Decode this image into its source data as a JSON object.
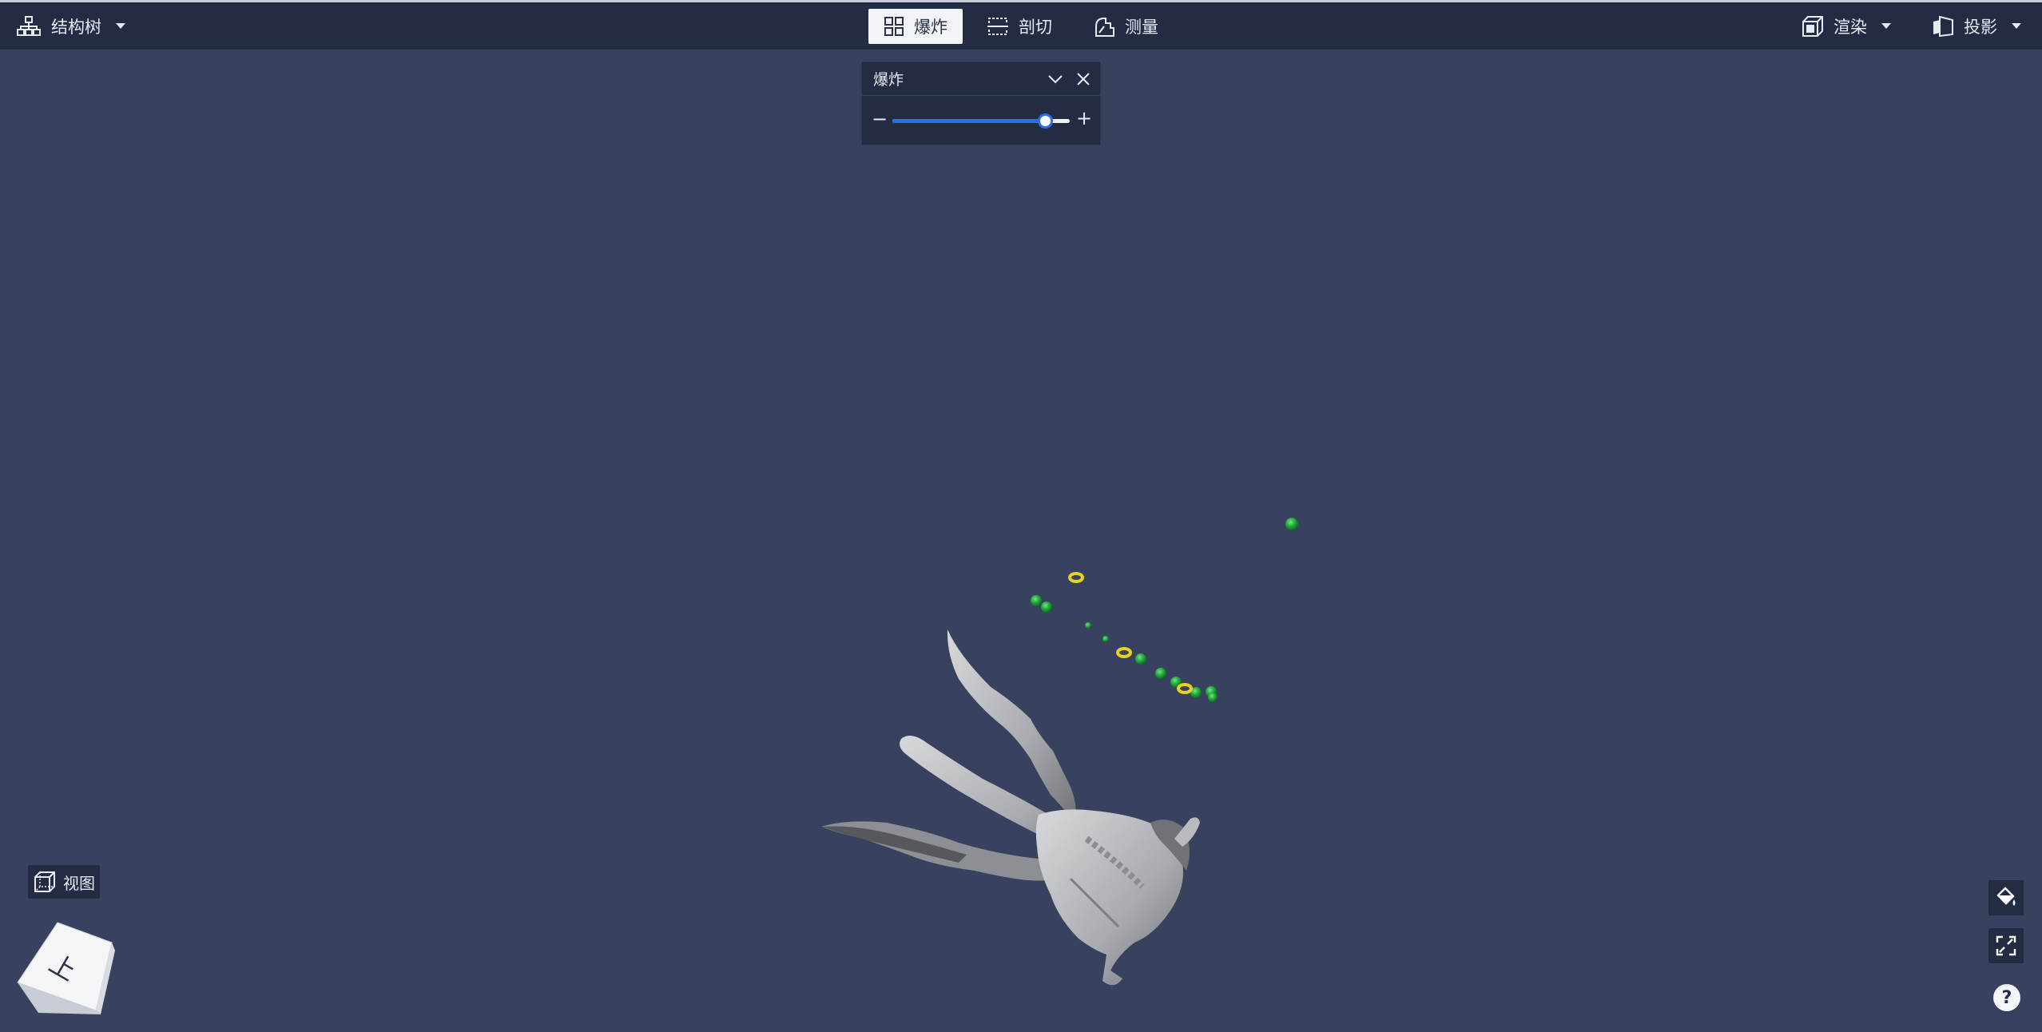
{
  "topbar": {
    "structure_tree": "结构树",
    "explode": "爆炸",
    "section": "剖切",
    "measure": "测量",
    "render": "渲染",
    "projection": "投影"
  },
  "explode_panel": {
    "title": "爆炸",
    "minus": "−",
    "plus": "+",
    "level_percent": 86
  },
  "view": {
    "label": "视图",
    "cube_face": "上"
  },
  "help": "?",
  "colors": {
    "background": "#38425e",
    "toolbar": "#232c42",
    "accent": "#2e6bf0",
    "green_parts": "#1fa83a",
    "yellow_parts": "#e8d21a",
    "model": "#b9bbbf"
  },
  "icons": {
    "structure_tree": "hierarchy-icon",
    "explode": "explode-grid-icon",
    "section": "section-cut-icon",
    "measure": "measure-icon",
    "render": "render-cube-icon",
    "projection": "projection-icon",
    "view": "wireframe-cube-icon",
    "paint": "paint-bucket-icon",
    "fullscreen": "fullscreen-icon"
  }
}
